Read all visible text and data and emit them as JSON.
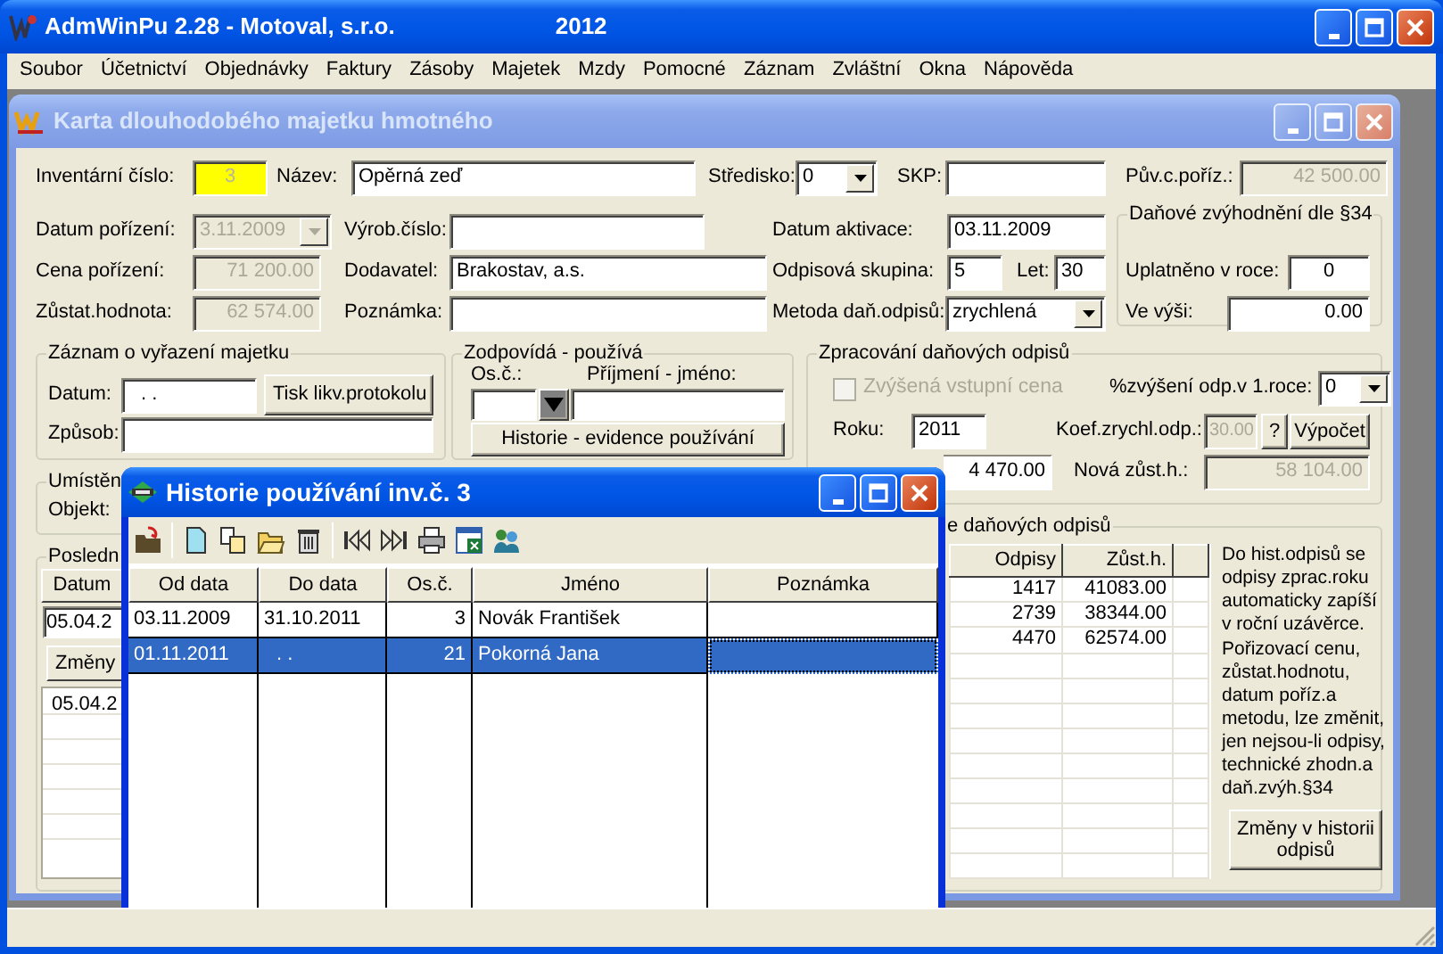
{
  "app_window": {
    "title": "AdmWinPu 2.28 - Motoval, s.r.o.",
    "year": "2012"
  },
  "menu": [
    "Soubor",
    "Účetnictví",
    "Objednávky",
    "Faktury",
    "Zásoby",
    "Majetek",
    "Mzdy",
    "Pomocné",
    "Záznam",
    "Zvláštní",
    "Okna",
    "Nápověda"
  ],
  "card_window": {
    "title": "Karta dlouhodobého majetku hmotného",
    "row_1": [
      {
        "label": "Inventární číslo:",
        "kind": "text",
        "value": "3",
        "disabled": false,
        "highlighted": true
      },
      {
        "label": "Název:",
        "kind": "text",
        "value": "Opěrná zeď",
        "disabled": false,
        "highlighted": false
      },
      {
        "label": "Středisko:",
        "kind": "combo",
        "value": "0",
        "disabled": false,
        "highlighted": false
      },
      {
        "label": "SKP:",
        "kind": "text",
        "disabled": false,
        "highlighted": false
      },
      {
        "label": "Pův.c.poříz.:",
        "kind": "text",
        "value": "42 500.00",
        "disabled": true,
        "highlighted": false
      }
    ],
    "row_2": [
      {
        "label": "Datum pořízení:",
        "kind": "combo",
        "value": "3.11.2009",
        "disabled": true,
        "highlighted": false
      },
      {
        "label": "Výrob.číslo:",
        "kind": "text",
        "disabled": false,
        "highlighted": false
      },
      {
        "label": "Datum aktivace:",
        "kind": "text",
        "value": "03.11.2009",
        "disabled": false,
        "highlighted": false
      }
    ],
    "row_3": [
      {
        "label": "Cena pořízení:",
        "kind": "text",
        "value": "71 200.00",
        "disabled": true,
        "highlighted": false
      },
      {
        "label": "Dodavatel:",
        "kind": "text",
        "value": "Brakostav, a.s.",
        "disabled": false,
        "highlighted": false
      },
      {
        "label": "Odpisová skupina:",
        "kind": "text",
        "value": "5",
        "disabled": false,
        "highlighted": false
      },
      {
        "label": "Let:",
        "kind": "text",
        "value": "30",
        "disabled": false,
        "highlighted": false
      }
    ],
    "row_4": [
      {
        "label": "Zůstat.hodnota:",
        "kind": "text",
        "value": "62 574.00",
        "disabled": true,
        "highlighted": false
      },
      {
        "label": "Poznámka:",
        "kind": "text",
        "disabled": false,
        "highlighted": false
      },
      {
        "label": "Metoda daň.odpisů:",
        "kind": "combo",
        "value": "zrychlená",
        "disabled": false,
        "highlighted": false
      }
    ],
    "tax_benefit": {
      "title": "Daňové zvýhodnění dle §34",
      "fields": [
        {
          "label": "Uplatněno v roce:",
          "kind": "text",
          "value": "0",
          "disabled": false,
          "highlighted": false
        },
        {
          "label": "Ve výši:",
          "kind": "text",
          "value": "0.00",
          "disabled": false,
          "highlighted": false
        }
      ]
    },
    "disposal": {
      "title": "Záznam o vyřazení majetku",
      "date_label": "Datum:",
      "date_value": ". .",
      "print_button": "Tisk likv.protokolu",
      "method_label": "Způsob:"
    },
    "responsible": {
      "title": "Zodpovídá - používá",
      "number_label": "Os.č.:",
      "name_label": "Příjmení - jméno:",
      "history_button": "Historie - evidence používání"
    },
    "tax_processing": {
      "title": "Zpracování daňových odpisů",
      "increased_price": {
        "label": "Zvýšená vstupní cena",
        "checked": false,
        "disabled": true
      },
      "increase_label": "%zvýšení odp.v 1.roce:",
      "increase_value": "0",
      "year_label": "Roku:",
      "year_value": "2011",
      "coef_label": "Koef.zrychl.odp.:",
      "coef_value": "30.00",
      "help_button": "?",
      "calc_button": "Výpočet",
      "amount_value": "4 470.00",
      "new_value_label": "Nová zůst.h.:",
      "new_value": "58 104.00"
    },
    "location": {
      "title": "Umístěn",
      "object_label": "Objekt:"
    },
    "last_changes": {
      "title": "Posledn",
      "column": "Datum",
      "date_value": "05.04.2",
      "changes_button": "Změny",
      "rows": [
        "05.04.2"
      ]
    },
    "tax_history": {
      "title": "e daňových odpisů",
      "columns": [
        "Odpisy",
        "Zůst.h."
      ],
      "rows": [
        [
          "1417",
          "41083.00"
        ],
        [
          "2739",
          "38344.00"
        ],
        [
          "4470",
          "62574.00"
        ]
      ],
      "note": "Do hist.odpisů se odpisy zprac.roku automaticky zapíší v roční uzávěrce. Pořizovací cenu, zůstat.hodnotu, datum poříz.a metodu, lze změnit, jen nejsou-li odpisy, technické zhodn.a daň.zvýh.§34",
      "changes_button": "Změny v historii odpisů"
    }
  },
  "history_window": {
    "title": "Historie používání inv.č. 3",
    "columns": [
      "Od data",
      "Do data",
      "Os.č.",
      "Jméno",
      "Poznámka"
    ],
    "rows": [
      {
        "cells": [
          "03.11.2009",
          "31.10.2011",
          "3",
          "Novák František"
        ],
        "selected": false
      },
      {
        "cells": [
          "01.11.2011",
          ". .",
          "21",
          "Pokorná Jana"
        ],
        "selected": true
      }
    ]
  }
}
